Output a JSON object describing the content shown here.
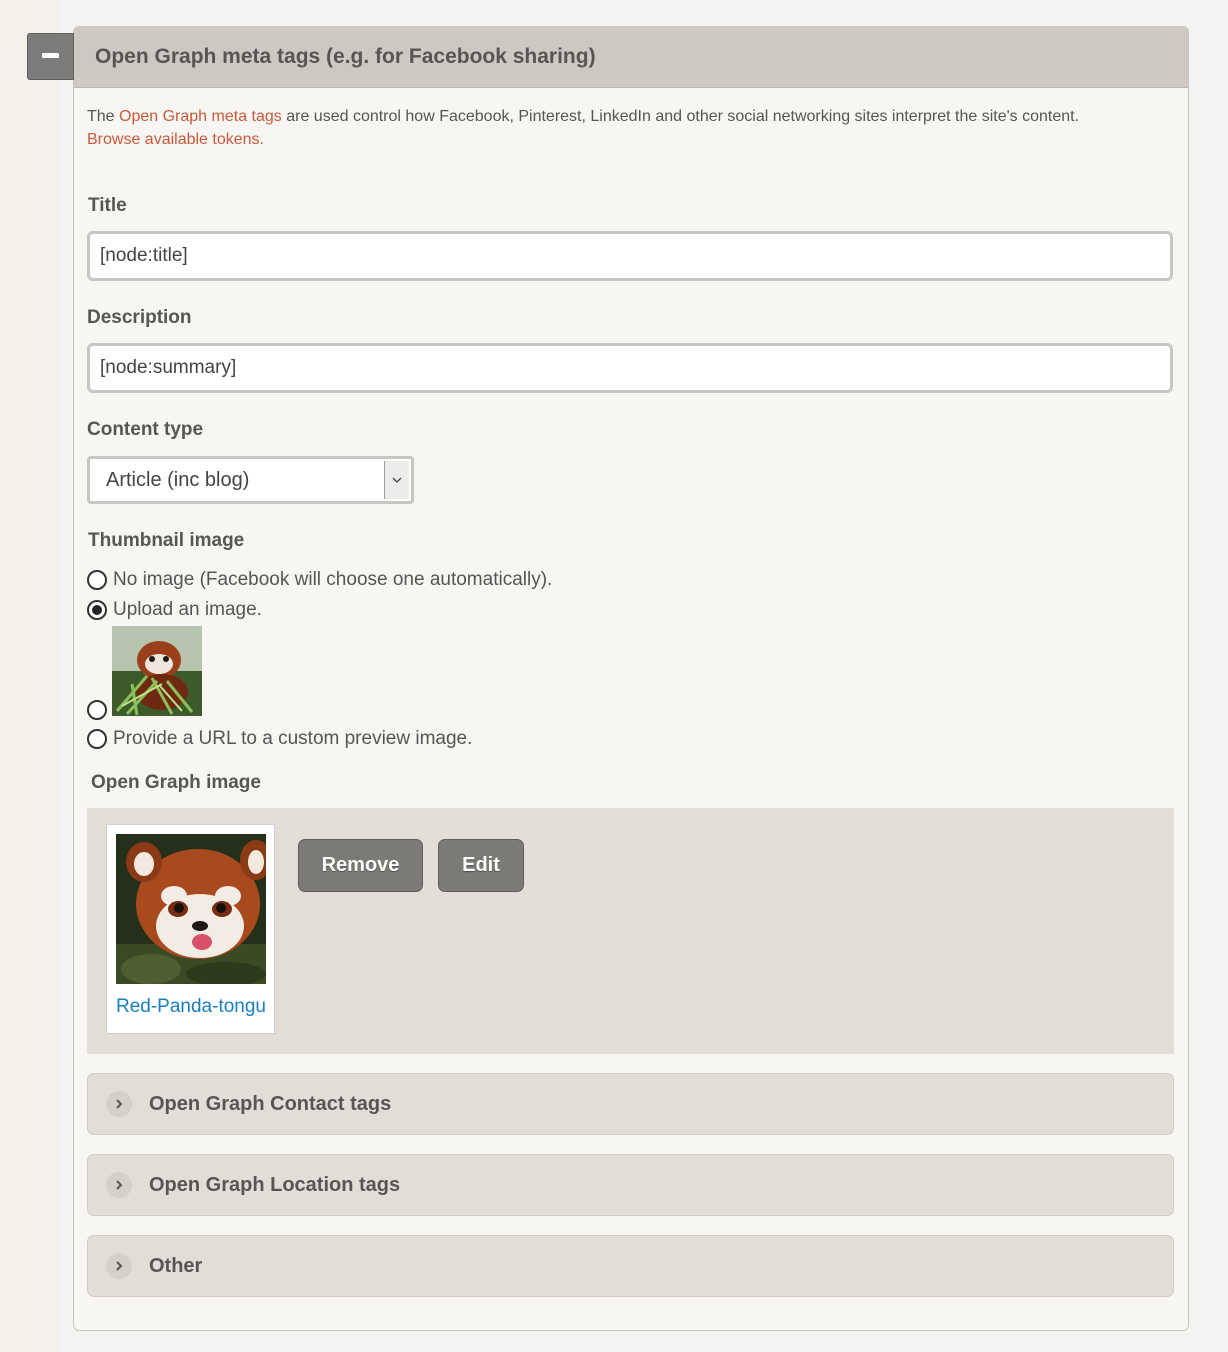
{
  "panel": {
    "title": "Open Graph meta tags (e.g. for Facebook sharing)",
    "collapse_icon": "minus-icon"
  },
  "intro": {
    "prefix": "The ",
    "link_text": "Open Graph meta tags",
    "suffix": " are used control how Facebook, Pinterest, LinkedIn and other social networking sites interpret the site's content.",
    "tokens_link": "Browse available tokens."
  },
  "fields": {
    "title_label": "Title",
    "title_value": "[node:title]",
    "description_label": "Description",
    "description_value": "[node:summary]",
    "content_type_label": "Content type",
    "content_type_value": "Article (inc blog)"
  },
  "thumbnail": {
    "label": "Thumbnail image",
    "options": [
      {
        "label": "No image (Facebook will choose one automatically).",
        "checked": false
      },
      {
        "label": "Upload an image.",
        "checked": true
      },
      {
        "label": "",
        "checked": false,
        "image": "red-panda-eating-thumbnail"
      },
      {
        "label": "Provide a URL to a custom preview image.",
        "checked": false
      }
    ]
  },
  "og_image": {
    "label": "Open Graph image",
    "file_name": "Red-Panda-tongu",
    "remove_label": "Remove",
    "edit_label": "Edit"
  },
  "sections": [
    {
      "title": "Open Graph Contact tags",
      "icon": "chevron-right-icon"
    },
    {
      "title": "Open Graph Location tags",
      "icon": "chevron-right-icon"
    },
    {
      "title": "Other",
      "icon": "chevron-right-icon"
    }
  ],
  "colors": {
    "link": "#c95a3b",
    "file_link": "#1a7fc0",
    "header_bg": "#cdc9c2",
    "button_bg": "#7b7a77"
  }
}
